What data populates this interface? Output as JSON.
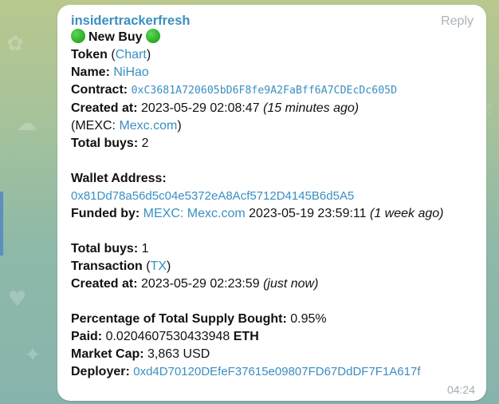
{
  "theme": {
    "link_color": "#3a8fc1",
    "bubble_bg": "#ffffff"
  },
  "message": {
    "sender": "insidertrackerfresh",
    "reply_label": "Reply",
    "time": "04:24",
    "title": "New Buy",
    "icons": [
      "green-circle-emoji",
      "green-circle-emoji"
    ],
    "token": {
      "label": "Token",
      "open_paren": " (",
      "chart_link": "Chart",
      "close_paren": ")"
    },
    "name": {
      "label": "Name:",
      "value": "NiHao"
    },
    "contract": {
      "label": "Contract:",
      "value": "0xC3681A720605bD6F8fe9A2FaBff6A7CDEcDc605D"
    },
    "created_token": {
      "label": "Created at:",
      "value": "2023-05-29 02:08:47",
      "relative": "(15 minutes ago)"
    },
    "exchange": {
      "prefix": "(MEXC: ",
      "link": "Mexc.com",
      "suffix": ")"
    },
    "total_buys_token": {
      "label": "Total buys:",
      "value": "2"
    },
    "wallet": {
      "label": "Wallet Address:",
      "value": "0x81Dd78a56d5c04e5372eA8Acf5712D4145B6d5A5"
    },
    "funded": {
      "label": "Funded by:",
      "link": "MEXC: Mexc.com",
      "date": "2023-05-19 23:59:11",
      "relative": "(1 week ago)"
    },
    "total_buys_wallet": {
      "label": "Total buys:",
      "value": "1"
    },
    "transaction": {
      "label": "Transaction",
      "open_paren": " (",
      "link": "TX",
      "close_paren": ")"
    },
    "created_tx": {
      "label": "Created at:",
      "value": "2023-05-29 02:23:59",
      "relative": "(just now)"
    },
    "percentage": {
      "label": "Percentage of Total Supply Bought:",
      "value": "0.95%"
    },
    "paid": {
      "label": "Paid:",
      "value": "0.0204607530433948",
      "unit": "ETH"
    },
    "market_cap": {
      "label": "Market Cap:",
      "value": "3,863 USD"
    },
    "deployer": {
      "label": "Deployer:",
      "value": "0xd4D70120DEfeF37615e09807FD67DdDF7F1A617f"
    }
  }
}
